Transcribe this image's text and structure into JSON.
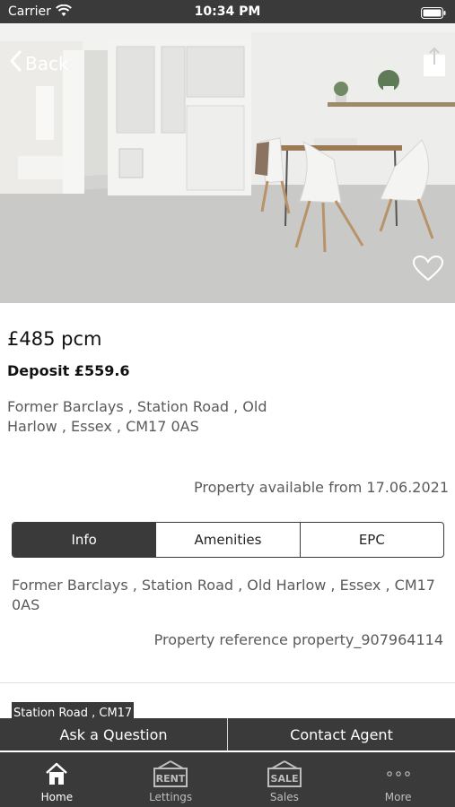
{
  "status": {
    "carrier": "Carrier",
    "time": "10:34 PM"
  },
  "nav": {
    "back_label": "Back"
  },
  "property": {
    "price": "£485 pcm",
    "deposit": "Deposit £559.6",
    "address": "Former Barclays , Station Road , Old Harlow , Essex , CM17 0AS",
    "available": "Property available from 17.06.2021"
  },
  "tabs": [
    {
      "label": "Info",
      "active": true
    },
    {
      "label": "Amenities",
      "active": false
    },
    {
      "label": "EPC",
      "active": false
    }
  ],
  "info": {
    "address": "Former Barclays , Station Road , Old Harlow , Essex , CM17 0AS",
    "reference": "Property reference property_907964114",
    "map_tag": "Station Road , CM17"
  },
  "actions": {
    "ask": "Ask a Question",
    "contact": "Contact Agent"
  },
  "tab_bar": [
    {
      "label": "Home",
      "icon": "home-icon",
      "active": true
    },
    {
      "label": "Lettings",
      "icon": "rent-sign-icon",
      "badge": "RENT",
      "active": false
    },
    {
      "label": "Sales",
      "icon": "sale-sign-icon",
      "badge": "SALE",
      "active": false
    },
    {
      "label": "More",
      "icon": "more-icon",
      "active": false
    }
  ],
  "colors": {
    "dark": "#3a3a3a",
    "text_muted": "#5a5a5a"
  }
}
